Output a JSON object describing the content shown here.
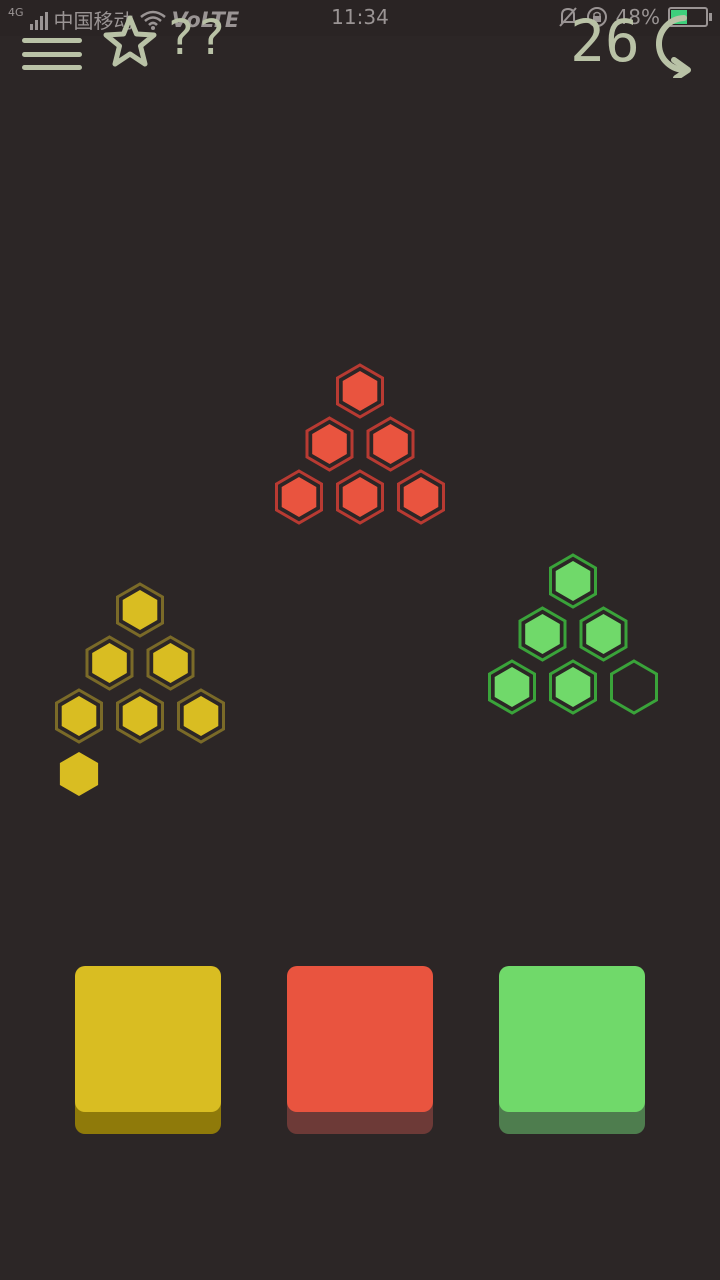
{
  "status_bar": {
    "network": "4G",
    "carrier": "中国移动",
    "volte": "VoLTE",
    "time": "11:34",
    "battery_percent": "48%",
    "battery_level": 0.48
  },
  "toolbar": {
    "icons": [
      "menu-icon",
      "star-icon",
      "hint-icon",
      "undo-icon"
    ],
    "hint_label": "??",
    "moves_count": "26"
  },
  "colors": {
    "background": "#2c2626",
    "yellow": "#d9bd22",
    "yellow_outline": "#7a6a28",
    "yellow_shadow": "#8f7a0a",
    "red": "#e9543f",
    "red_outline": "#b83a32",
    "red_shadow": "#6d3a37",
    "green": "#70d96a",
    "green_outline": "#3aa33a",
    "green_shadow": "#4e7d4e",
    "ui_icon": "#b9c2a6"
  },
  "piles": [
    {
      "color": "yellow",
      "slots": 6,
      "filled": 6,
      "loose": 1
    },
    {
      "color": "red",
      "slots": 6,
      "filled": 6,
      "loose": 0
    },
    {
      "color": "green",
      "slots": 6,
      "filled": 5,
      "loose": 0
    }
  ],
  "buttons": [
    {
      "color": "yellow"
    },
    {
      "color": "red"
    },
    {
      "color": "green"
    }
  ]
}
